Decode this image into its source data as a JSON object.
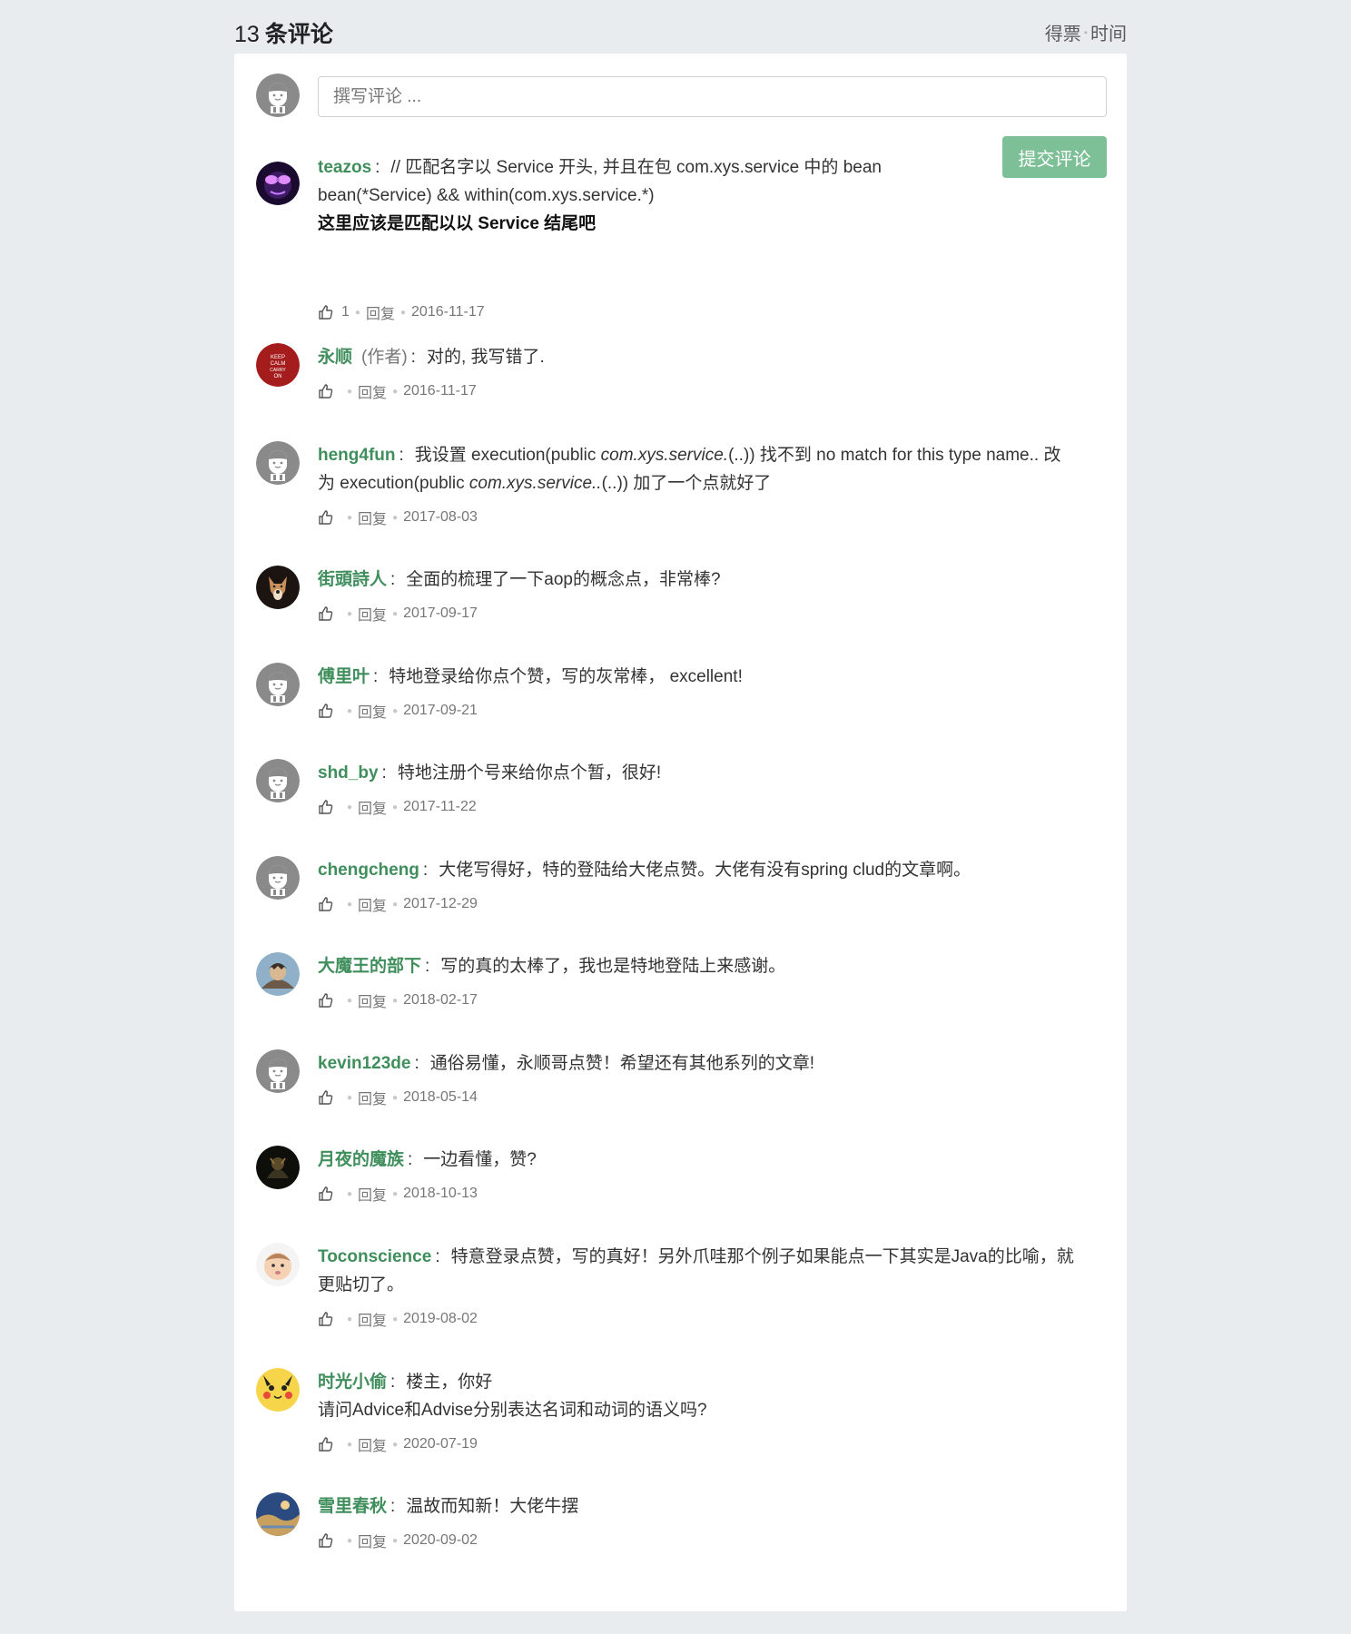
{
  "header": {
    "count": "13",
    "title": "条评论",
    "sort_votes": "得票",
    "sort_time": "时间"
  },
  "compose": {
    "placeholder": "撰写评论 ...",
    "submit_label": "提交评论"
  },
  "meta_labels": {
    "reply": "回复"
  },
  "colors": {
    "username": "#3f8e5c",
    "submit": "#7dbf96",
    "background": "#e9ecef"
  },
  "comments": [
    {
      "user": "teazos",
      "line1": "// 匹配名字以 Service 开头, 并且在包 com.xys.service 中的 bean",
      "line2": "bean(*Service) && within(com.xys.service.*)",
      "line3": "这里应该是匹配以以 Service 结尾吧",
      "likes": "1",
      "date": "2016-11-17",
      "avatar": "purple-glasses-avatar"
    },
    {
      "user": "永顺",
      "author_tag": "(作者)",
      "text": "对的, 我写错了.",
      "date": "2016-11-17",
      "avatar": "keep-calm-avatar"
    },
    {
      "user": "heng4fun",
      "text_a": "我设置 execution(public ",
      "text_a_italic": "com.xys.service.",
      "text_a2": "(..)) 找不到 no match for this type name.. 改",
      "text_b": "为 execution(public ",
      "text_b_italic": "com.xys.service..",
      "text_b2": "(..)) 加了一个点就好了",
      "date": "2017-08-03",
      "avatar": "default-avatar"
    },
    {
      "user": "街頭詩人",
      "text": "全面的梳理了一下aop的概念点，非常棒?",
      "date": "2017-09-17",
      "avatar": "dog-avatar"
    },
    {
      "user": "傅里叶",
      "text": "特地登录给你点个赞，写的灰常棒， excellent!",
      "date": "2017-09-21",
      "avatar": "default-avatar"
    },
    {
      "user": "shd_by",
      "text": "特地注册个号来给你点个暂，很好!",
      "date": "2017-11-22",
      "avatar": "default-avatar"
    },
    {
      "user": "chengcheng",
      "text": "大佬写得好，特的登陆给大佬点赞。大佬有没有spring clud的文章啊。",
      "date": "2017-12-29",
      "avatar": "default-avatar"
    },
    {
      "user": "大魔王的部下",
      "text": "写的真的太棒了，我也是特地登陆上来感谢。",
      "date": "2018-02-17",
      "avatar": "anime-avatar"
    },
    {
      "user": "kevin123de",
      "text": "通俗易懂，永顺哥点赞！希望还有其他系列的文章!",
      "date": "2018-05-14",
      "avatar": "default-avatar"
    },
    {
      "user": "月夜的魔族",
      "text": "一边看懂，赞?",
      "date": "2018-10-13",
      "avatar": "dark-avatar"
    },
    {
      "user": "Toconscience",
      "text_a": "特意登录点赞，写的真好！另外爪哇那个例子如果能点一下其实是Java的比喻，就",
      "text_b": "更贴切了。",
      "date": "2019-08-02",
      "avatar": "baby-avatar"
    },
    {
      "user": "时光小偷",
      "text_a": "楼主，你好",
      "text_b": "请问Advice和Advise分别表达名词和动词的语义吗?",
      "date": "2020-07-19",
      "avatar": "pikachu-avatar"
    },
    {
      "user": "雪里春秋",
      "text": "温故而知新！大佬牛摆",
      "date": "2020-09-02",
      "avatar": "landscape-avatar"
    }
  ]
}
